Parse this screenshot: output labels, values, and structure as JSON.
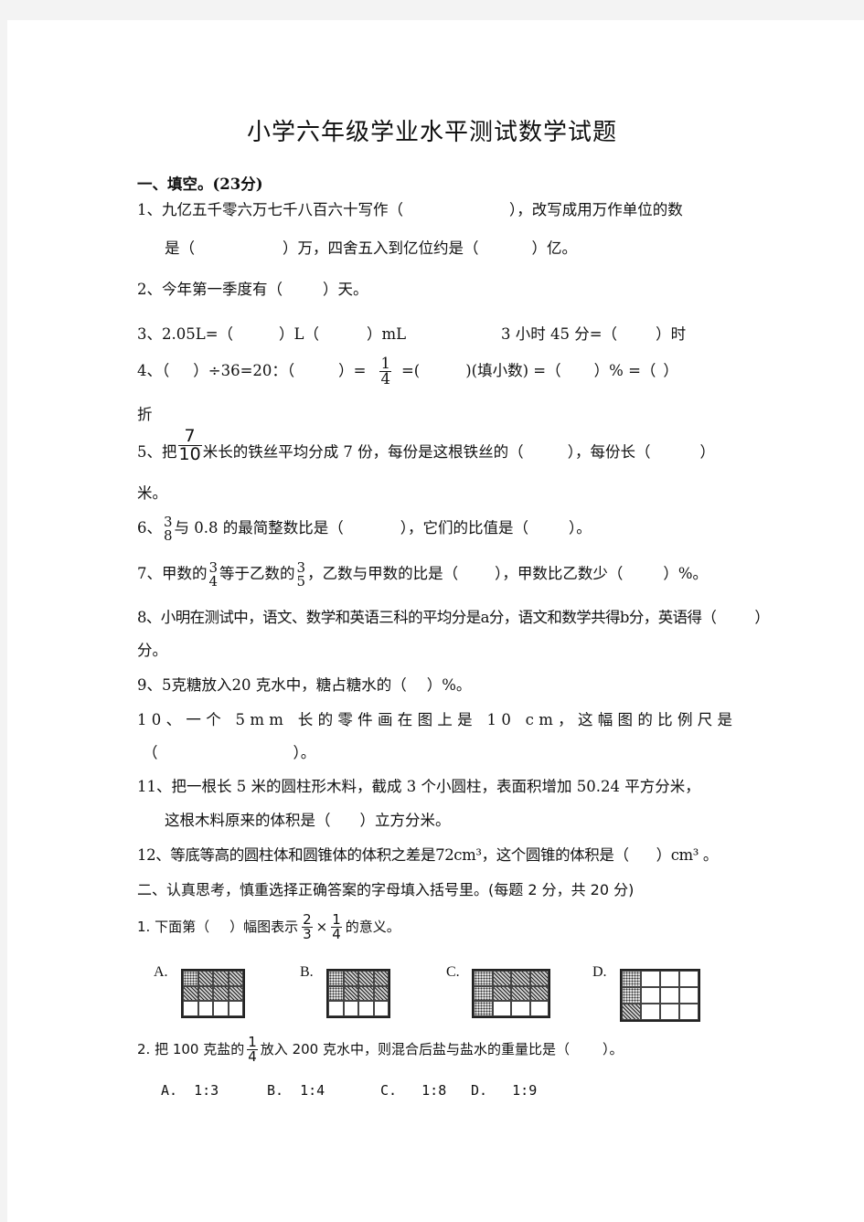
{
  "title": "小学六年级学业水平测试数学试题",
  "section1": {
    "heading": "一、填空。(23分)",
    "q1": {
      "a": "1、九亿五千零六万七千八百六十写作（",
      "b": "），改写成用万作单位的数",
      "c": "是（",
      "d": "）万，四舍五入到亿位约是（",
      "e": "）亿。"
    },
    "q2": {
      "a": "2、今年第一季度有（",
      "b": "）天。"
    },
    "q3": {
      "a": "3、2.05L=（",
      "b": "）L（",
      "c": "）mL",
      "d": "3 小时 45 分=（",
      "e": "）时"
    },
    "q4": {
      "a": "4、（",
      "b": "）÷36=20：（",
      "c": "）=",
      "frac_num": "1",
      "frac_den": "4",
      "d": "=(",
      "e": ")(填小数) =（",
      "f": "）% =（",
      "g": "）",
      "h": "折"
    },
    "q5": {
      "frac_num": "7",
      "frac_den": "10",
      "a": "5、把",
      "b": "米长的铁丝平均分成 7 份，每份是这根铁丝的（",
      "c": "），每份长（",
      "d": "）",
      "e": "米。"
    },
    "q6": {
      "a": "6、",
      "frac_num": "3",
      "frac_den": "8",
      "b": "与 0.8 的最简整数比是（",
      "c": "），它们的比值是（",
      "d": "）。"
    },
    "q7": {
      "a": "7、甲数的",
      "f1_num": "3",
      "f1_den": "4",
      "b": "等于乙数的",
      "f2_num": "3",
      "f2_den": "5",
      "c": "，乙数与甲数的比是（",
      "d": "），甲数比乙数少（",
      "e": "）%。"
    },
    "q8": {
      "a": "8、小明在测试中，语文、数学和英语三科的平均分是a分，语文和数学共得b分，英语得（",
      "b": "）",
      "c": "分。"
    },
    "q9": {
      "a": "9、5克糖放入20 克水中，糖占糖水的（",
      "b": "）%。"
    },
    "q10": {
      "a": "10、一个  5mm  长的零件画在图上是  10  cm，这幅图的比例尺是",
      "b": "（",
      "c": "）。"
    },
    "q11": {
      "a": "11、把一根长 5 米的圆柱形木料，截成 3 个小圆柱，表面积增加 50.24 平方分米，",
      "b": "这根木料原来的体积是（",
      "c": "）立方分米。"
    },
    "q12": {
      "a": "12、等底等高的圆柱体和圆锥体的体积之差是72cm³，这个圆锥的体积是（",
      "b": "）cm³ 。"
    }
  },
  "section2": {
    "heading": "二、认真思考，慎重选择正确答案的字母填入括号里。(每题 2 分，共 20 分)",
    "q1": {
      "a": "1. 下面第（",
      "b": "）幅图表示",
      "f1_num": "2",
      "f1_den": "3",
      "times": "×",
      "f2_num": "1",
      "f2_den": "4",
      "c": "的意义。",
      "options": [
        {
          "label": "A.",
          "rows": 3,
          "cols": 4,
          "cells": [
            "d",
            "h",
            "h",
            "h",
            "h",
            "h",
            "h",
            "h",
            "w",
            "w",
            "w",
            "w"
          ]
        },
        {
          "label": "B.",
          "rows": 3,
          "cols": 4,
          "cells": [
            "d",
            "h",
            "h",
            "h",
            "d",
            "h",
            "h",
            "h",
            "w",
            "w",
            "w",
            "w"
          ]
        },
        {
          "label": "C.",
          "rows": 3,
          "cols": 4,
          "cells": [
            "d",
            "h",
            "h",
            "h",
            "d",
            "h",
            "h",
            "h",
            "d",
            "w",
            "w",
            "w"
          ]
        },
        {
          "label": "D.",
          "rows": 3,
          "cols": 4,
          "cells": [
            "d",
            "w",
            "w",
            "w",
            "d",
            "w",
            "w",
            "w",
            "h",
            "w",
            "w",
            "w"
          ]
        }
      ]
    },
    "q2": {
      "a": "2. 把 100 克盐的",
      "frac_num": "1",
      "frac_den": "4",
      "b": "放入 200 克水中，则混合后盐与盐水的重量比是（",
      "c": "）。",
      "options": [
        {
          "label": "A.",
          "value": "1:3"
        },
        {
          "label": "B.",
          "value": "1:4"
        },
        {
          "label": "C.",
          "value": "1:8"
        },
        {
          "label": "D.",
          "value": "1:9"
        }
      ]
    }
  }
}
